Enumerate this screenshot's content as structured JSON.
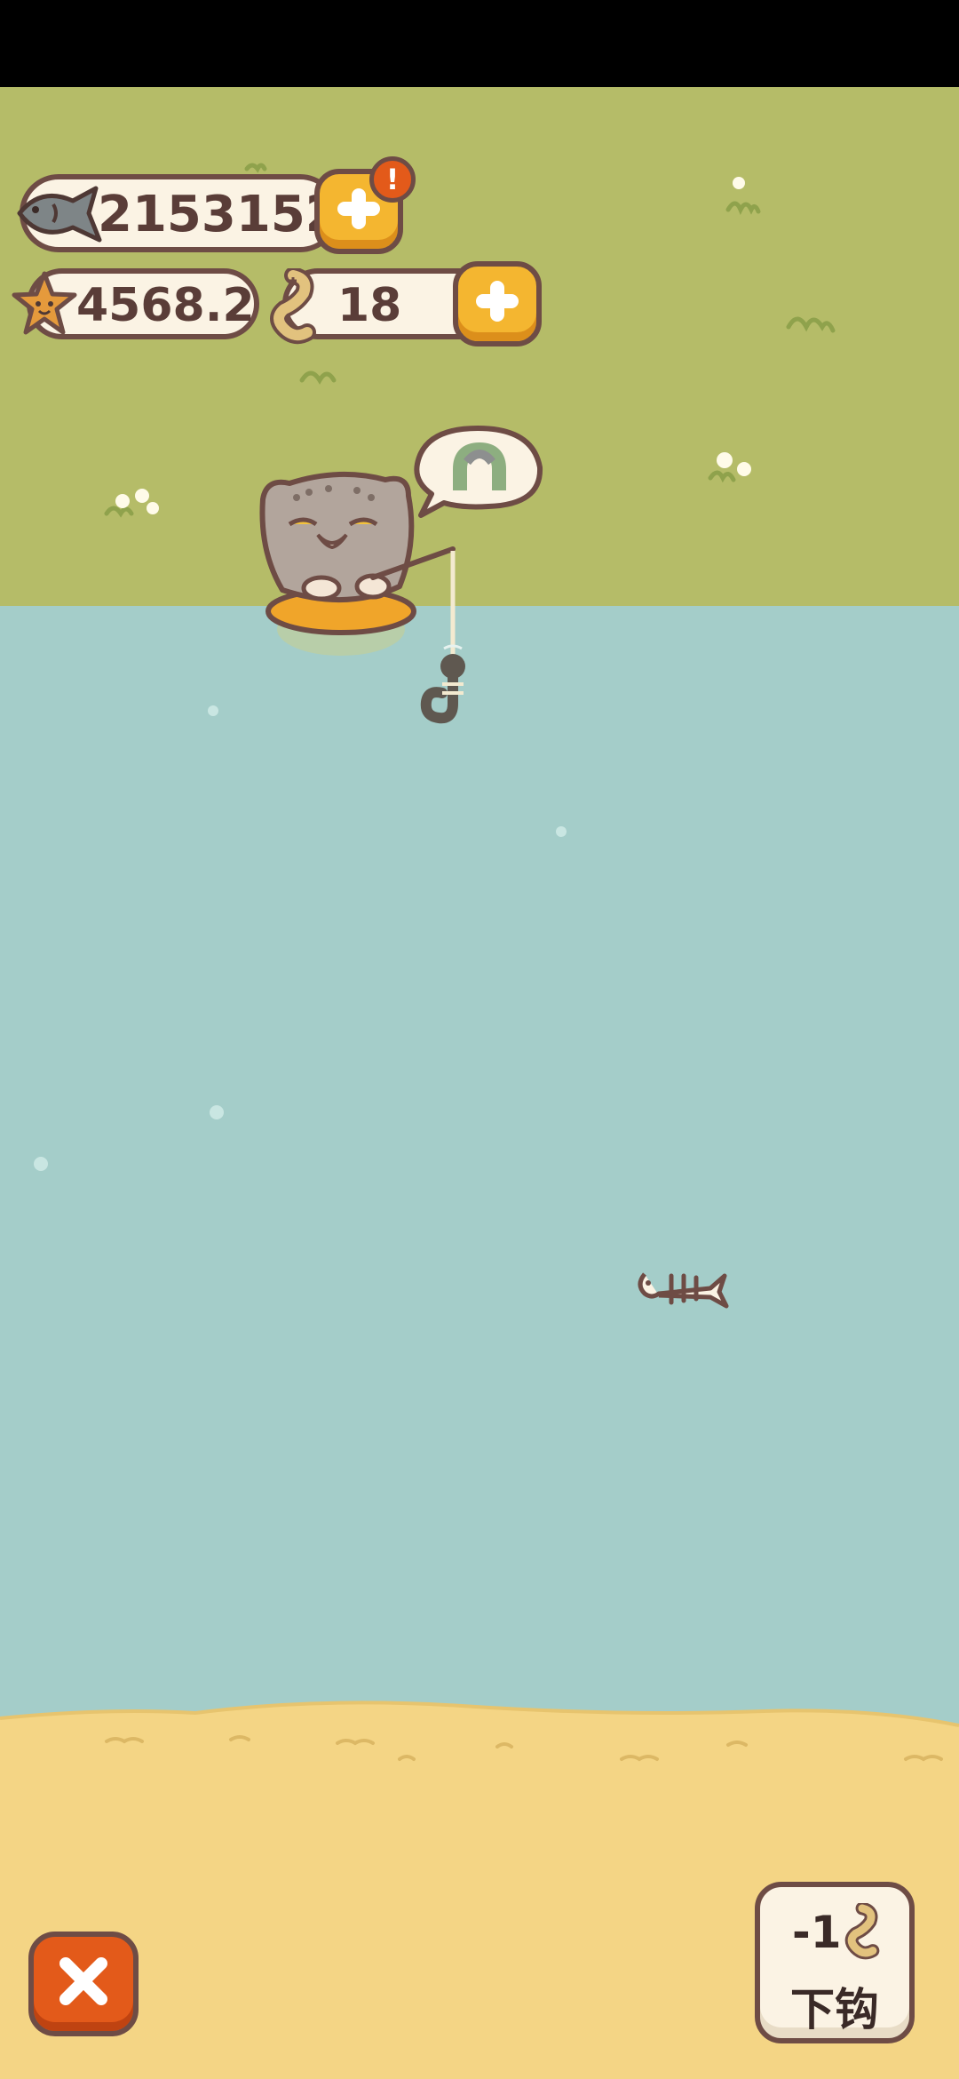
{
  "currencies": {
    "fish_count": "2153152",
    "star_count": "4568.2",
    "bait_count": "18",
    "alert_badge": "!"
  },
  "icons": {
    "fish": "fish-icon",
    "star": "starfish-icon",
    "bait": "bait-worm-icon",
    "plus": "plus-icon",
    "alert": "alert-icon",
    "close": "close-icon",
    "fishbone": "fishbone-icon",
    "hook": "fishing-hook-icon",
    "magnet": "magnet-icon"
  },
  "cast_button": {
    "cost": "-1",
    "label": "下钩"
  },
  "colors": {
    "grass": "#b5bc68",
    "water": "#a4cdc9",
    "sand": "#f4d585",
    "accent_orange": "#e35a1a",
    "button_yellow": "#f4b630",
    "outline_brown": "#6e4c45"
  }
}
